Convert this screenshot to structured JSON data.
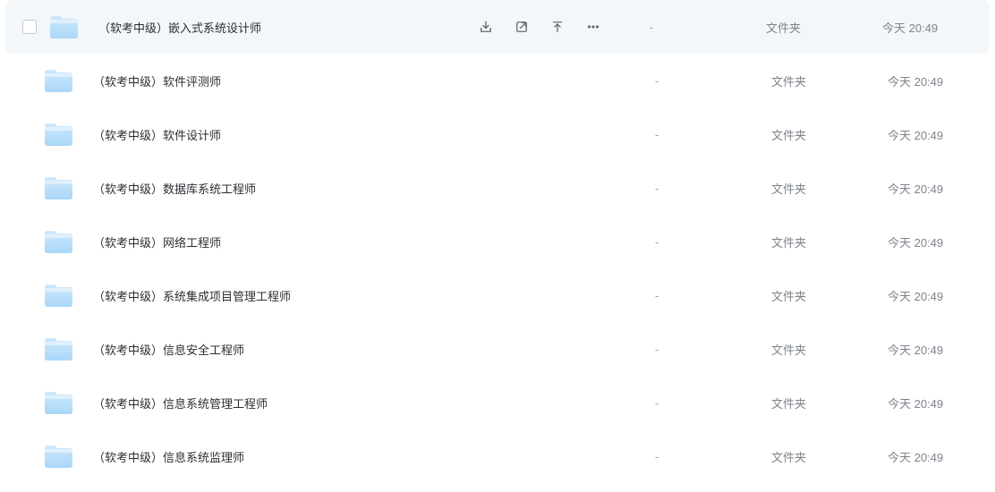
{
  "folders": [
    {
      "name": "（软考中级）嵌入式系统设计师",
      "size": "-",
      "type": "文件夹",
      "time": "今天 20:49",
      "hovered": true
    },
    {
      "name": "（软考中级）软件评测师",
      "size": "-",
      "type": "文件夹",
      "time": "今天 20:49",
      "hovered": false
    },
    {
      "name": "（软考中级）软件设计师",
      "size": "-",
      "type": "文件夹",
      "time": "今天 20:49",
      "hovered": false
    },
    {
      "name": "（软考中级）数据库系统工程师",
      "size": "-",
      "type": "文件夹",
      "time": "今天 20:49",
      "hovered": false
    },
    {
      "name": "（软考中级）网络工程师",
      "size": "-",
      "type": "文件夹",
      "time": "今天 20:49",
      "hovered": false
    },
    {
      "name": "（软考中级）系统集成项目管理工程师",
      "size": "-",
      "type": "文件夹",
      "time": "今天 20:49",
      "hovered": false
    },
    {
      "name": "（软考中级）信息安全工程师",
      "size": "-",
      "type": "文件夹",
      "time": "今天 20:49",
      "hovered": false
    },
    {
      "name": "（软考中级）信息系统管理工程师",
      "size": "-",
      "type": "文件夹",
      "time": "今天 20:49",
      "hovered": false
    },
    {
      "name": "（软考中级）信息系统监理师",
      "size": "-",
      "type": "文件夹",
      "time": "今天 20:49",
      "hovered": false
    }
  ],
  "colors": {
    "folder_light": "#cfe8fc",
    "folder_dark": "#a9d7f8"
  }
}
